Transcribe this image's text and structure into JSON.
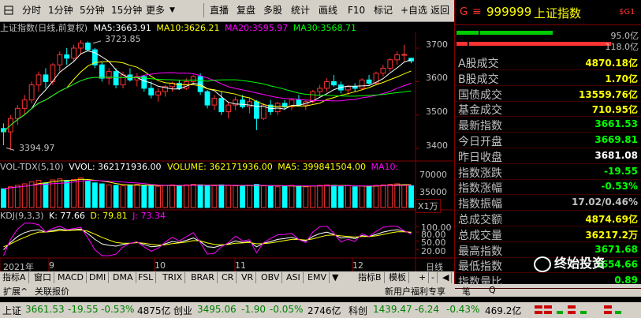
{
  "toolbar": {
    "items": [
      "分时",
      "1分钟",
      "5分钟",
      "15分钟",
      "更多",
      "直播",
      "复盘",
      "多股",
      "统计",
      "画线",
      "F10",
      "标记",
      "+自选",
      "返回"
    ]
  },
  "header": {
    "index_code": "999999",
    "index_name": "上证指数",
    "badge": "$G1",
    "g_label": "G",
    "eq_label": "≡"
  },
  "chart_title": {
    "name": "上证指数(日线,前复权)",
    "ma5_label": "MA5:",
    "ma5": "3663.91",
    "ma10_label": "MA10:",
    "ma10": "3626.21",
    "ma20_label": "MA20:",
    "ma20": "3595.97",
    "ma30_label": "MA30:",
    "ma30": "3568.71"
  },
  "price_axis": [
    "3700",
    "3600",
    "3500",
    "3400"
  ],
  "annotations": {
    "high": "3723.85",
    "low": "3394.97"
  },
  "volume_title": {
    "name": "VOL-TDX(5,10)",
    "vvol": "VVOL: 362171936.00",
    "volume": "VOLUME: 362171936.00",
    "ma5": "MA5: 399841504.00",
    "ma10": "MA10:"
  },
  "volume_axis": [
    "70000",
    "35000"
  ],
  "volume_unit": "X1万",
  "kdj_title": {
    "name": "KDJ(9,3,3)",
    "k": "K: 77.66",
    "d": "D: 79.81",
    "j": "J: 73.34"
  },
  "kdj_axis": [
    "100.00",
    "80.00",
    "50.00",
    "20.00"
  ],
  "time_axis": {
    "year": "2021年",
    "months": [
      "9",
      "10",
      "11",
      "12"
    ],
    "period": "日线"
  },
  "bottom_tabs": [
    "指标A",
    "窗口",
    "MACD",
    "DMI",
    "DMA",
    "FSL",
    "TRIX",
    "BRAR",
    "CR",
    "VR",
    "OBV",
    "ASI",
    "EMV",
    "指标B",
    "模板"
  ],
  "bottom_tab_arrow": "▼",
  "bottom_controls": [
    "+",
    "-",
    "◀"
  ],
  "status_bar": {
    "left": [
      "扩展^",
      "关联报价"
    ],
    "right": [
      "新用户福利专享",
      "笔",
      "Q"
    ]
  },
  "right_panel": {
    "bar1_value": "95.0亿",
    "bar2_value": "118.0亿",
    "rows": [
      {
        "label": "A股成交",
        "value": "4870.18亿",
        "color": "#ffff00"
      },
      {
        "label": "B股成交",
        "value": "1.70亿",
        "color": "#ffff00"
      },
      {
        "label": "国债成交",
        "value": "13559.76亿",
        "color": "#ffff00"
      },
      {
        "label": "基金成交",
        "value": "710.95亿",
        "color": "#ffff00"
      },
      {
        "label": "最新指数",
        "value": "3661.53",
        "color": "#00ff00"
      },
      {
        "label": "今日开盘",
        "value": "3669.81",
        "color": "#00ff00"
      },
      {
        "label": "昨日收盘",
        "value": "3681.08",
        "color": "#ffffff"
      },
      {
        "label": "指数涨跌",
        "value": "-19.55",
        "color": "#00ff00"
      },
      {
        "label": "指数涨幅",
        "value": "-0.53%",
        "color": "#00ff00"
      },
      {
        "label": "指数振幅",
        "value": "17.02/0.46%",
        "color": "#c0c0c0"
      },
      {
        "label": "总成交额",
        "value": "4874.69亿",
        "color": "#ffff00"
      },
      {
        "label": "总成交量",
        "value": "36217.2万",
        "color": "#ffff00"
      },
      {
        "label": "最高指数",
        "value": "3671.68",
        "color": "#00ff00"
      },
      {
        "label": "最低指数",
        "value": "3654.66",
        "color": "#00ff00"
      },
      {
        "label": "指数量比",
        "value": "0.89",
        "color": "#00ff00"
      }
    ],
    "watermark": "终始投资"
  },
  "ticker": [
    {
      "name": "上证",
      "price": "3661.53",
      "chg": "-19.55",
      "pct": "-0.53%",
      "amt": "4875亿"
    },
    {
      "name": "创业",
      "price": "3495.06",
      "chg": "-1.90",
      "pct": "-0.05%",
      "amt": "2746亿"
    },
    {
      "name": "科创",
      "price": "1439.47",
      "chg": "-6.24",
      "pct": "-0.43%",
      "amt": "469.2亿"
    }
  ],
  "colors": {
    "up": "#ff3232",
    "down": "#00ffff",
    "ma5": "#ffffff",
    "ma10": "#ffff00",
    "ma20": "#ff00ff",
    "ma30": "#00ff00"
  },
  "chart_data": {
    "type": "candlestick",
    "price_range": [
      3370,
      3740
    ],
    "candles_ohlc": [
      [
        3460,
        3475,
        3410,
        3450
      ],
      [
        3450,
        3500,
        3395,
        3490
      ],
      [
        3490,
        3530,
        3470,
        3520
      ],
      [
        3520,
        3560,
        3500,
        3545
      ],
      [
        3545,
        3600,
        3535,
        3590
      ],
      [
        3590,
        3630,
        3570,
        3620
      ],
      [
        3620,
        3640,
        3580,
        3600
      ],
      [
        3600,
        3655,
        3590,
        3650
      ],
      [
        3650,
        3690,
        3630,
        3680
      ],
      [
        3680,
        3700,
        3650,
        3670
      ],
      [
        3670,
        3710,
        3660,
        3700
      ],
      [
        3700,
        3723.85,
        3680,
        3715
      ],
      [
        3715,
        3720,
        3690,
        3695
      ],
      [
        3695,
        3700,
        3640,
        3650
      ],
      [
        3650,
        3660,
        3600,
        3610
      ],
      [
        3610,
        3640,
        3590,
        3630
      ],
      [
        3630,
        3640,
        3580,
        3590
      ],
      [
        3590,
        3630,
        3580,
        3620
      ],
      [
        3620,
        3640,
        3600,
        3605
      ],
      [
        3605,
        3625,
        3585,
        3615
      ],
      [
        3615,
        3620,
        3570,
        3580
      ],
      [
        3580,
        3600,
        3550,
        3560
      ],
      [
        3560,
        3580,
        3540,
        3570
      ],
      [
        3570,
        3590,
        3555,
        3585
      ],
      [
        3585,
        3600,
        3570,
        3595
      ],
      [
        3595,
        3605,
        3575,
        3580
      ],
      [
        3580,
        3610,
        3575,
        3600
      ],
      [
        3600,
        3620,
        3590,
        3615
      ],
      [
        3615,
        3625,
        3560,
        3570
      ],
      [
        3570,
        3575,
        3520,
        3530
      ],
      [
        3530,
        3560,
        3515,
        3550
      ],
      [
        3550,
        3570,
        3500,
        3510
      ],
      [
        3510,
        3540,
        3490,
        3530
      ],
      [
        3530,
        3555,
        3515,
        3545
      ],
      [
        3545,
        3560,
        3520,
        3525
      ],
      [
        3525,
        3550,
        3505,
        3540
      ],
      [
        3540,
        3545,
        3455,
        3490
      ],
      [
        3490,
        3535,
        3485,
        3530
      ],
      [
        3530,
        3545,
        3500,
        3510
      ],
      [
        3510,
        3540,
        3500,
        3535
      ],
      [
        3535,
        3545,
        3515,
        3525
      ],
      [
        3525,
        3550,
        3515,
        3545
      ],
      [
        3545,
        3560,
        3525,
        3530
      ],
      [
        3530,
        3545,
        3515,
        3540
      ],
      [
        3540,
        3575,
        3535,
        3570
      ],
      [
        3570,
        3590,
        3555,
        3580
      ],
      [
        3580,
        3610,
        3570,
        3600
      ],
      [
        3600,
        3620,
        3585,
        3590
      ],
      [
        3590,
        3600,
        3565,
        3575
      ],
      [
        3575,
        3590,
        3560,
        3585
      ],
      [
        3585,
        3595,
        3570,
        3580
      ],
      [
        3580,
        3610,
        3575,
        3605
      ],
      [
        3605,
        3620,
        3590,
        3595
      ],
      [
        3595,
        3630,
        3590,
        3625
      ],
      [
        3625,
        3650,
        3615,
        3640
      ],
      [
        3640,
        3670,
        3630,
        3665
      ],
      [
        3665,
        3690,
        3650,
        3680
      ],
      [
        3680,
        3710,
        3660,
        3681
      ],
      [
        3669.81,
        3671.68,
        3654.66,
        3661.53
      ]
    ],
    "volumes": [
      38,
      42,
      45,
      48,
      52,
      55,
      50,
      56,
      58,
      55,
      57,
      60,
      54,
      50,
      48,
      46,
      45,
      44,
      46,
      47,
      45,
      44,
      43,
      45,
      46,
      44,
      46,
      47,
      46,
      45,
      44,
      46,
      45,
      44,
      43,
      45,
      47,
      44,
      43,
      42,
      44,
      45,
      43,
      42,
      44,
      45,
      46,
      45,
      43,
      44,
      42,
      44,
      43,
      45,
      46,
      47,
      48,
      46,
      44
    ],
    "kdj_k": [
      20,
      45,
      65,
      78,
      85,
      88,
      80,
      85,
      90,
      86,
      88,
      90,
      75,
      55,
      40,
      35,
      32,
      38,
      42,
      45,
      38,
      30,
      32,
      40,
      48,
      45,
      52,
      60,
      48,
      30,
      28,
      35,
      40,
      50,
      45,
      48,
      30,
      42,
      48,
      55,
      58,
      62,
      55,
      50,
      65,
      75,
      80,
      72,
      60,
      62,
      58,
      68,
      65,
      72,
      80,
      85,
      88,
      82,
      77.66
    ],
    "kdj_d": [
      30,
      40,
      52,
      62,
      72,
      80,
      80,
      82,
      85,
      85,
      86,
      87,
      83,
      73,
      62,
      53,
      45,
      42,
      42,
      44,
      42,
      38,
      36,
      37,
      41,
      43,
      46,
      51,
      50,
      43,
      38,
      37,
      38,
      42,
      43,
      45,
      40,
      41,
      43,
      47,
      51,
      55,
      55,
      53,
      57,
      63,
      69,
      70,
      67,
      65,
      63,
      65,
      65,
      67,
      72,
      77,
      81,
      81,
      79.81
    ],
    "kdj_j": [
      0,
      55,
      90,
      110,
      110,
      105,
      80,
      92,
      100,
      88,
      92,
      96,
      60,
      20,
      0,
      0,
      5,
      30,
      42,
      47,
      30,
      15,
      25,
      46,
      62,
      50,
      64,
      78,
      44,
      5,
      8,
      30,
      44,
      66,
      50,
      54,
      10,
      44,
      58,
      71,
      72,
      76,
      55,
      44,
      80,
      98,
      100,
      76,
      46,
      56,
      48,
      74,
      65,
      82,
      96,
      100,
      100,
      84,
      73.34
    ],
    "kdj_range": [
      0,
      115
    ]
  }
}
